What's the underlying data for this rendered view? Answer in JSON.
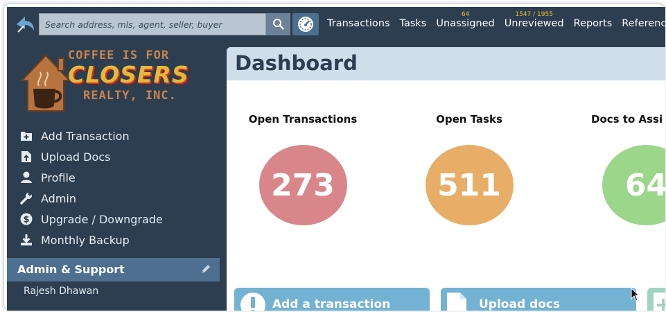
{
  "search": {
    "placeholder": "Search address, mls, agent, seller, buyer"
  },
  "nav": [
    {
      "label": "Transactions",
      "badge": ""
    },
    {
      "label": "Tasks",
      "badge": ""
    },
    {
      "label": "Unassigned",
      "badge": "64"
    },
    {
      "label": "Unreviewed",
      "badge": "1547 / 1955"
    },
    {
      "label": "Reports",
      "badge": ""
    },
    {
      "label": "Reference",
      "badge": ""
    }
  ],
  "brand": {
    "line1": "COFFEE IS FOR",
    "line2": "CLOSERS",
    "line3": "REALTY, INC."
  },
  "sidebar": {
    "items": [
      {
        "label": "Add Transaction",
        "icon": "add-transaction-icon"
      },
      {
        "label": "Upload Docs",
        "icon": "upload-docs-icon"
      },
      {
        "label": "Profile",
        "icon": "profile-icon"
      },
      {
        "label": "Admin",
        "icon": "wrench-icon"
      },
      {
        "label": "Upgrade / Downgrade",
        "icon": "dollar-icon"
      },
      {
        "label": "Monthly Backup",
        "icon": "download-icon"
      }
    ],
    "admin_section": "Admin & Support",
    "user": "Rajesh Dhawan"
  },
  "dashboard": {
    "title": "Dashboard",
    "stats": [
      {
        "title": "Open Transactions",
        "value": "273",
        "color": "#d9868a"
      },
      {
        "title": "Open Tasks",
        "value": "511",
        "color": "#e8ae68"
      },
      {
        "title": "Docs to Assi",
        "value": "64",
        "color": "#9cd68a"
      }
    ],
    "actions": [
      {
        "label": "Add a transaction"
      },
      {
        "label": "Upload docs"
      }
    ]
  },
  "colors": {
    "topbar": "#2c3e50",
    "accent": "#4e6f8f",
    "badge": "#e8c22f"
  }
}
